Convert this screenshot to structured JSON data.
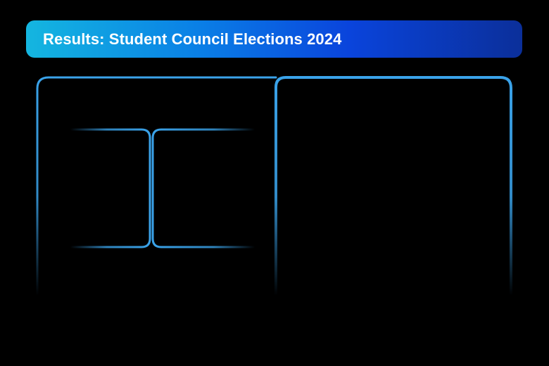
{
  "header": {
    "title": "Results: Student Council Elections 2024"
  },
  "colors": {
    "background": "#000000",
    "title_gradient_start": "#14b6e0",
    "title_gradient_end": "#0b2f9a",
    "outline": "#3aa3ea",
    "title_text": "#ffffff"
  }
}
